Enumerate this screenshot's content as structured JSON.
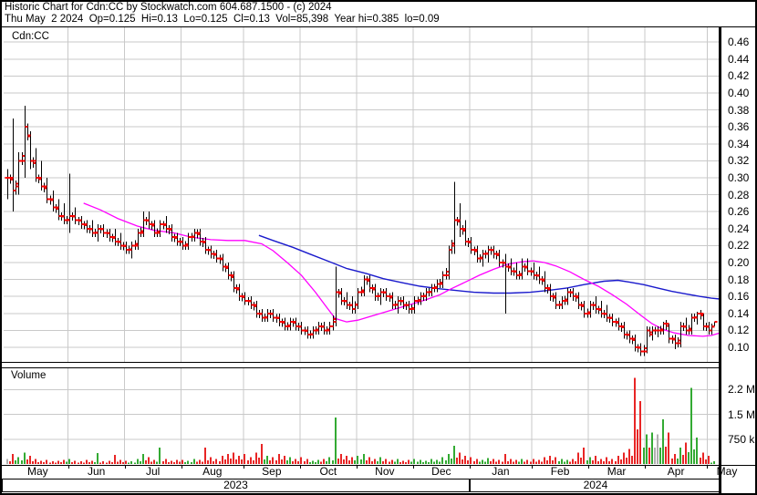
{
  "header": {
    "line1": "Historic Chart for Cdn:CC by Stockwatch.com 604.687.1500 - (c) 2024",
    "line2": "Thu May  2 2024  Op=0.125  Hi=0.13  Lo=0.125  Cl=0.13  Vol=85,398  Year hi=0.385  lo=0.09"
  },
  "price_panel": {
    "symbol_label": "Cdn:CC",
    "axis_labels": [
      "0.46",
      "0.44",
      "0.42",
      "0.40",
      "0.38",
      "0.36",
      "0.34",
      "0.32",
      "0.30",
      "0.28",
      "0.26",
      "0.24",
      "0.22",
      "0.20",
      "0.18",
      "0.16",
      "0.14",
      "0.12",
      "0.10"
    ]
  },
  "volume_panel": {
    "title": "Volume",
    "axis_labels": [
      {
        "label": "2.2 M",
        "value": 2.25
      },
      {
        "label": "1.5 M",
        "value": 1.5
      },
      {
        "label": "750 k",
        "value": 0.75
      }
    ]
  },
  "time_axis": {
    "months": [
      "May",
      "Jun",
      "Jul",
      "Aug",
      "Sep",
      "Oct",
      "Nov",
      "Dec",
      "Jan",
      "Feb",
      "Mar",
      "Apr",
      "May"
    ],
    "years": [
      {
        "label": "2023"
      },
      {
        "label": "2024"
      }
    ]
  },
  "colors": {
    "background": "#ffffff",
    "border": "#000000",
    "grid": "#c9c9c9",
    "bar": "#000000",
    "tick_red": "#ff0000",
    "ma_short_magenta": "#ff00ff",
    "ma_long_blue": "#1a1acc",
    "vol_up_green": "#33aa33",
    "vol_down_red": "#e82525",
    "vol_flat_gray": "#b0b0b0",
    "text": "#000000"
  },
  "chart_data": {
    "type": "ohlc+volume",
    "symbol": "Cdn:CC",
    "title": "Historic Chart for Cdn:CC",
    "ylim": [
      0.083,
      0.477
    ],
    "price_tick_step": 0.02,
    "grid": true,
    "last_bar": {
      "date": "Thu May 2 2024",
      "open": 0.125,
      "high": 0.13,
      "low": 0.125,
      "close": 0.13,
      "volume": 85398
    },
    "year_high": 0.385,
    "year_low": 0.09,
    "render_expand": 2,
    "month_start_bar_index": [
      0,
      11,
      21,
      31,
      42,
      52,
      62,
      72,
      82,
      93,
      103,
      113,
      124
    ],
    "bars_ohlc": [
      [
        0.3,
        0.31,
        0.275,
        0.3
      ],
      [
        0.3,
        0.37,
        0.26,
        0.285
      ],
      [
        0.29,
        0.33,
        0.28,
        0.32
      ],
      [
        0.32,
        0.385,
        0.3,
        0.36
      ],
      [
        0.35,
        0.355,
        0.31,
        0.32
      ],
      [
        0.32,
        0.335,
        0.295,
        0.3
      ],
      [
        0.3,
        0.32,
        0.285,
        0.29
      ],
      [
        0.29,
        0.3,
        0.27,
        0.275
      ],
      [
        0.275,
        0.285,
        0.26,
        0.265
      ],
      [
        0.265,
        0.275,
        0.25,
        0.255
      ],
      [
        0.255,
        0.27,
        0.245,
        0.25
      ],
      [
        0.25,
        0.305,
        0.235,
        0.255
      ],
      [
        0.255,
        0.265,
        0.245,
        0.25
      ],
      [
        0.25,
        0.255,
        0.24,
        0.245
      ],
      [
        0.245,
        0.25,
        0.235,
        0.24
      ],
      [
        0.24,
        0.25,
        0.23,
        0.235
      ],
      [
        0.235,
        0.245,
        0.225,
        0.24
      ],
      [
        0.24,
        0.245,
        0.23,
        0.235
      ],
      [
        0.235,
        0.24,
        0.225,
        0.23
      ],
      [
        0.23,
        0.24,
        0.22,
        0.225
      ],
      [
        0.225,
        0.235,
        0.215,
        0.22
      ],
      [
        0.22,
        0.225,
        0.21,
        0.215
      ],
      [
        0.215,
        0.225,
        0.205,
        0.22
      ],
      [
        0.22,
        0.24,
        0.215,
        0.235
      ],
      [
        0.235,
        0.26,
        0.23,
        0.25
      ],
      [
        0.25,
        0.26,
        0.24,
        0.245
      ],
      [
        0.245,
        0.25,
        0.23,
        0.235
      ],
      [
        0.235,
        0.25,
        0.23,
        0.245
      ],
      [
        0.245,
        0.255,
        0.235,
        0.24
      ],
      [
        0.24,
        0.245,
        0.225,
        0.23
      ],
      [
        0.23,
        0.235,
        0.22,
        0.225
      ],
      [
        0.225,
        0.23,
        0.215,
        0.22
      ],
      [
        0.22,
        0.235,
        0.215,
        0.23
      ],
      [
        0.23,
        0.24,
        0.225,
        0.235
      ],
      [
        0.235,
        0.24,
        0.22,
        0.225
      ],
      [
        0.225,
        0.23,
        0.21,
        0.215
      ],
      [
        0.215,
        0.22,
        0.205,
        0.21
      ],
      [
        0.21,
        0.215,
        0.2,
        0.205
      ],
      [
        0.205,
        0.21,
        0.19,
        0.195
      ],
      [
        0.195,
        0.2,
        0.18,
        0.185
      ],
      [
        0.185,
        0.19,
        0.165,
        0.17
      ],
      [
        0.17,
        0.175,
        0.155,
        0.16
      ],
      [
        0.16,
        0.165,
        0.15,
        0.155
      ],
      [
        0.155,
        0.16,
        0.145,
        0.15
      ],
      [
        0.15,
        0.155,
        0.135,
        0.14
      ],
      [
        0.14,
        0.145,
        0.13,
        0.135
      ],
      [
        0.135,
        0.145,
        0.13,
        0.14
      ],
      [
        0.14,
        0.145,
        0.13,
        0.135
      ],
      [
        0.135,
        0.14,
        0.125,
        0.13
      ],
      [
        0.13,
        0.135,
        0.12,
        0.125
      ],
      [
        0.125,
        0.135,
        0.12,
        0.13
      ],
      [
        0.13,
        0.135,
        0.12,
        0.125
      ],
      [
        0.125,
        0.13,
        0.115,
        0.12
      ],
      [
        0.12,
        0.125,
        0.11,
        0.115
      ],
      [
        0.115,
        0.125,
        0.11,
        0.12
      ],
      [
        0.12,
        0.13,
        0.115,
        0.125
      ],
      [
        0.125,
        0.13,
        0.115,
        0.12
      ],
      [
        0.12,
        0.13,
        0.115,
        0.125
      ],
      [
        0.13,
        0.195,
        0.125,
        0.165
      ],
      [
        0.165,
        0.17,
        0.15,
        0.155
      ],
      [
        0.155,
        0.165,
        0.145,
        0.15
      ],
      [
        0.15,
        0.16,
        0.14,
        0.145
      ],
      [
        0.15,
        0.17,
        0.145,
        0.165
      ],
      [
        0.165,
        0.185,
        0.16,
        0.18
      ],
      [
        0.18,
        0.185,
        0.165,
        0.17
      ],
      [
        0.17,
        0.175,
        0.155,
        0.16
      ],
      [
        0.16,
        0.17,
        0.15,
        0.165
      ],
      [
        0.165,
        0.17,
        0.155,
        0.16
      ],
      [
        0.16,
        0.165,
        0.145,
        0.15
      ],
      [
        0.15,
        0.16,
        0.14,
        0.155
      ],
      [
        0.155,
        0.16,
        0.145,
        0.15
      ],
      [
        0.15,
        0.155,
        0.14,
        0.145
      ],
      [
        0.145,
        0.16,
        0.14,
        0.155
      ],
      [
        0.155,
        0.165,
        0.15,
        0.16
      ],
      [
        0.16,
        0.17,
        0.155,
        0.165
      ],
      [
        0.165,
        0.175,
        0.16,
        0.17
      ],
      [
        0.17,
        0.18,
        0.165,
        0.175
      ],
      [
        0.175,
        0.19,
        0.17,
        0.185
      ],
      [
        0.185,
        0.22,
        0.18,
        0.215
      ],
      [
        0.22,
        0.295,
        0.21,
        0.25
      ],
      [
        0.25,
        0.27,
        0.23,
        0.24
      ],
      [
        0.24,
        0.25,
        0.22,
        0.225
      ],
      [
        0.225,
        0.23,
        0.21,
        0.215
      ],
      [
        0.215,
        0.22,
        0.2,
        0.205
      ],
      [
        0.205,
        0.215,
        0.195,
        0.21
      ],
      [
        0.21,
        0.22,
        0.2,
        0.215
      ],
      [
        0.215,
        0.22,
        0.205,
        0.21
      ],
      [
        0.21,
        0.215,
        0.195,
        0.2
      ],
      [
        0.2,
        0.21,
        0.14,
        0.195
      ],
      [
        0.195,
        0.205,
        0.185,
        0.19
      ],
      [
        0.19,
        0.2,
        0.18,
        0.185
      ],
      [
        0.185,
        0.205,
        0.18,
        0.195
      ],
      [
        0.195,
        0.205,
        0.185,
        0.19
      ],
      [
        0.19,
        0.2,
        0.18,
        0.185
      ],
      [
        0.185,
        0.195,
        0.175,
        0.18
      ],
      [
        0.18,
        0.19,
        0.165,
        0.17
      ],
      [
        0.17,
        0.175,
        0.155,
        0.16
      ],
      [
        0.16,
        0.165,
        0.145,
        0.15
      ],
      [
        0.15,
        0.16,
        0.145,
        0.155
      ],
      [
        0.155,
        0.17,
        0.15,
        0.165
      ],
      [
        0.165,
        0.17,
        0.155,
        0.16
      ],
      [
        0.16,
        0.165,
        0.145,
        0.15
      ],
      [
        0.15,
        0.155,
        0.135,
        0.14
      ],
      [
        0.14,
        0.155,
        0.135,
        0.15
      ],
      [
        0.15,
        0.16,
        0.14,
        0.145
      ],
      [
        0.145,
        0.155,
        0.135,
        0.14
      ],
      [
        0.14,
        0.15,
        0.13,
        0.135
      ],
      [
        0.135,
        0.14,
        0.125,
        0.13
      ],
      [
        0.13,
        0.135,
        0.12,
        0.125
      ],
      [
        0.125,
        0.13,
        0.11,
        0.115
      ],
      [
        0.115,
        0.12,
        0.105,
        0.11
      ],
      [
        0.11,
        0.115,
        0.095,
        0.1
      ],
      [
        0.1,
        0.105,
        0.09,
        0.095
      ],
      [
        0.095,
        0.125,
        0.093,
        0.12
      ],
      [
        0.115,
        0.125,
        0.108,
        0.12
      ],
      [
        0.12,
        0.125,
        0.112,
        0.12
      ],
      [
        0.12,
        0.13,
        0.115,
        0.128
      ],
      [
        0.128,
        0.128,
        0.105,
        0.11
      ],
      [
        0.11,
        0.115,
        0.098,
        0.105
      ],
      [
        0.105,
        0.13,
        0.1,
        0.125
      ],
      [
        0.125,
        0.135,
        0.115,
        0.12
      ],
      [
        0.12,
        0.14,
        0.115,
        0.135
      ],
      [
        0.135,
        0.142,
        0.127,
        0.14
      ],
      [
        0.14,
        0.14,
        0.12,
        0.125
      ],
      [
        0.125,
        0.13,
        0.115,
        0.12
      ],
      [
        0.125,
        0.13,
        0.125,
        0.13
      ]
    ],
    "volumes_m": [
      0.15,
      0.3,
      0.2,
      0.35,
      0.25,
      0.15,
      0.1,
      0.12,
      0.08,
      0.1,
      0.12,
      0.15,
      0.1,
      0.08,
      0.12,
      0.1,
      0.33,
      0.08,
      0.1,
      0.28,
      0.12,
      0.1,
      0.08,
      0.15,
      0.3,
      0.2,
      0.12,
      0.5,
      0.15,
      0.1,
      0.12,
      0.12,
      0.1,
      0.15,
      0.12,
      0.5,
      0.2,
      0.15,
      0.25,
      0.3,
      0.35,
      0.25,
      0.3,
      0.2,
      0.35,
      0.6,
      0.25,
      0.2,
      0.3,
      0.25,
      0.2,
      0.15,
      0.2,
      0.15,
      0.1,
      0.12,
      0.15,
      0.2,
      1.4,
      0.3,
      0.25,
      0.2,
      0.25,
      0.3,
      0.2,
      0.15,
      0.2,
      0.15,
      0.12,
      0.15,
      0.1,
      0.12,
      0.15,
      0.12,
      0.1,
      0.15,
      0.12,
      0.2,
      0.3,
      0.55,
      0.35,
      0.25,
      0.2,
      0.15,
      0.12,
      0.18,
      0.15,
      0.12,
      0.3,
      0.15,
      0.12,
      0.15,
      0.12,
      0.15,
      0.12,
      0.2,
      0.25,
      0.2,
      0.15,
      0.12,
      0.15,
      0.35,
      0.5,
      0.2,
      0.25,
      0.15,
      0.2,
      0.15,
      0.25,
      0.35,
      0.45,
      2.6,
      1.9,
      0.9,
      0.95,
      0.9,
      1.35,
      0.95,
      0.3,
      0.5,
      0.65,
      2.3,
      0.8,
      0.35,
      0.25,
      0.085
    ],
    "ma_short_magenta": [
      [
        27,
        0.27
      ],
      [
        33,
        0.262
      ],
      [
        39,
        0.252
      ],
      [
        46,
        0.243
      ],
      [
        52,
        0.238
      ],
      [
        59,
        0.235
      ],
      [
        65,
        0.23
      ],
      [
        72,
        0.227
      ],
      [
        78,
        0.226
      ],
      [
        84,
        0.226
      ],
      [
        90,
        0.222
      ],
      [
        94,
        0.214
      ],
      [
        99,
        0.2
      ],
      [
        104,
        0.185
      ],
      [
        109,
        0.165
      ],
      [
        113,
        0.147
      ],
      [
        116,
        0.134
      ],
      [
        120,
        0.13
      ],
      [
        124,
        0.132
      ],
      [
        128,
        0.136
      ],
      [
        133,
        0.141
      ],
      [
        138,
        0.146
      ],
      [
        143,
        0.151
      ],
      [
        148,
        0.156
      ],
      [
        153,
        0.162
      ],
      [
        157,
        0.169
      ],
      [
        162,
        0.177
      ],
      [
        167,
        0.185
      ],
      [
        172,
        0.192
      ],
      [
        177,
        0.198
      ],
      [
        182,
        0.201
      ],
      [
        186,
        0.202
      ],
      [
        190,
        0.2
      ],
      [
        194,
        0.196
      ],
      [
        199,
        0.189
      ],
      [
        204,
        0.18
      ],
      [
        209,
        0.172
      ],
      [
        214,
        0.162
      ],
      [
        219,
        0.151
      ],
      [
        224,
        0.138
      ],
      [
        228,
        0.128
      ],
      [
        232,
        0.121
      ],
      [
        236,
        0.117
      ],
      [
        241,
        0.114
      ],
      [
        246,
        0.113
      ],
      [
        249,
        0.114
      ],
      [
        252,
        0.117
      ]
    ],
    "ma_long_blue": [
      [
        89,
        0.232
      ],
      [
        94,
        0.226
      ],
      [
        101,
        0.218
      ],
      [
        107,
        0.21
      ],
      [
        114,
        0.201
      ],
      [
        120,
        0.193
      ],
      [
        127,
        0.187
      ],
      [
        133,
        0.181
      ],
      [
        140,
        0.176
      ],
      [
        146,
        0.172
      ],
      [
        153,
        0.169
      ],
      [
        159,
        0.167
      ],
      [
        165,
        0.165
      ],
      [
        172,
        0.164
      ],
      [
        178,
        0.164
      ],
      [
        185,
        0.165
      ],
      [
        191,
        0.167
      ],
      [
        198,
        0.17
      ],
      [
        204,
        0.174
      ],
      [
        211,
        0.178
      ],
      [
        216,
        0.179
      ],
      [
        220,
        0.177
      ],
      [
        225,
        0.174
      ],
      [
        230,
        0.17
      ],
      [
        235,
        0.166
      ],
      [
        240,
        0.163
      ],
      [
        245,
        0.16
      ],
      [
        249,
        0.158
      ],
      [
        252,
        0.157
      ]
    ]
  }
}
